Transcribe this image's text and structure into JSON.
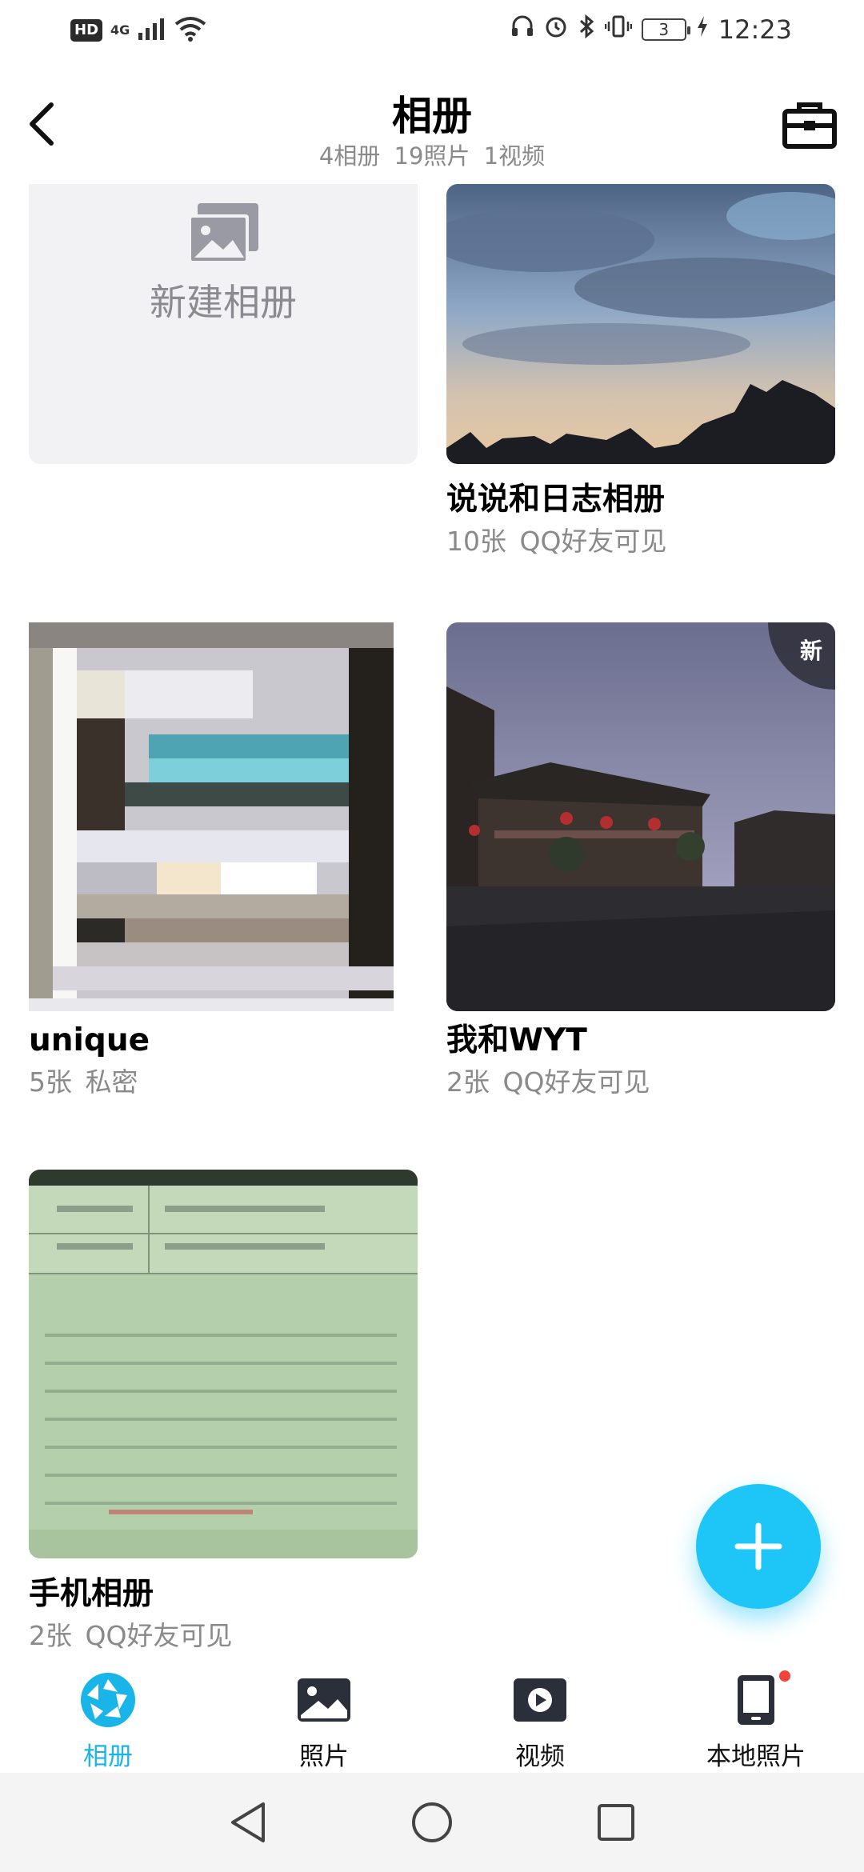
{
  "status_bar": {
    "hd": "HD",
    "network": "4G",
    "battery": "3",
    "time": "12:23"
  },
  "header": {
    "title": "相册",
    "subtitle": "4相册 19照片 1视频"
  },
  "new_album": {
    "label": "新建相册"
  },
  "albums": [
    {
      "name": "说说和日志相册",
      "meta": "10张 QQ好友可见",
      "cover_colors": [
        "#5d6f8c",
        "#8ea4c2",
        "#c8b9a8",
        "#1a1c20"
      ]
    },
    {
      "name": "unique",
      "meta": "5张 私密",
      "cover_colors": [
        "#d9d8de",
        "#2e2a24",
        "#5ab9c6",
        "#b7a99a"
      ]
    },
    {
      "name": "我和WYT",
      "meta": "2张 QQ好友可见",
      "badge": "新",
      "cover_colors": [
        "#6b6d8e",
        "#b5b3cf",
        "#3b332e",
        "#2c2c30"
      ]
    },
    {
      "name": "手机相册",
      "meta": "2张 QQ好友可见",
      "cover_colors": [
        "#b9d3b0",
        "#9cbf97",
        "#2e3a2e",
        "#c75a5a"
      ]
    }
  ],
  "bottom_nav": [
    {
      "label": "相册",
      "icon": "album-shutter-icon",
      "active": true
    },
    {
      "label": "照片",
      "icon": "photo-icon",
      "active": false
    },
    {
      "label": "视频",
      "icon": "video-play-icon",
      "active": false
    },
    {
      "label": "本地照片",
      "icon": "phone-icon",
      "active": false,
      "dot": true
    }
  ],
  "colors": {
    "accent": "#1ec5f7",
    "nav_active": "#19b5e8",
    "meta_text": "#8a8a8a",
    "badge_dot": "#f2433a"
  }
}
